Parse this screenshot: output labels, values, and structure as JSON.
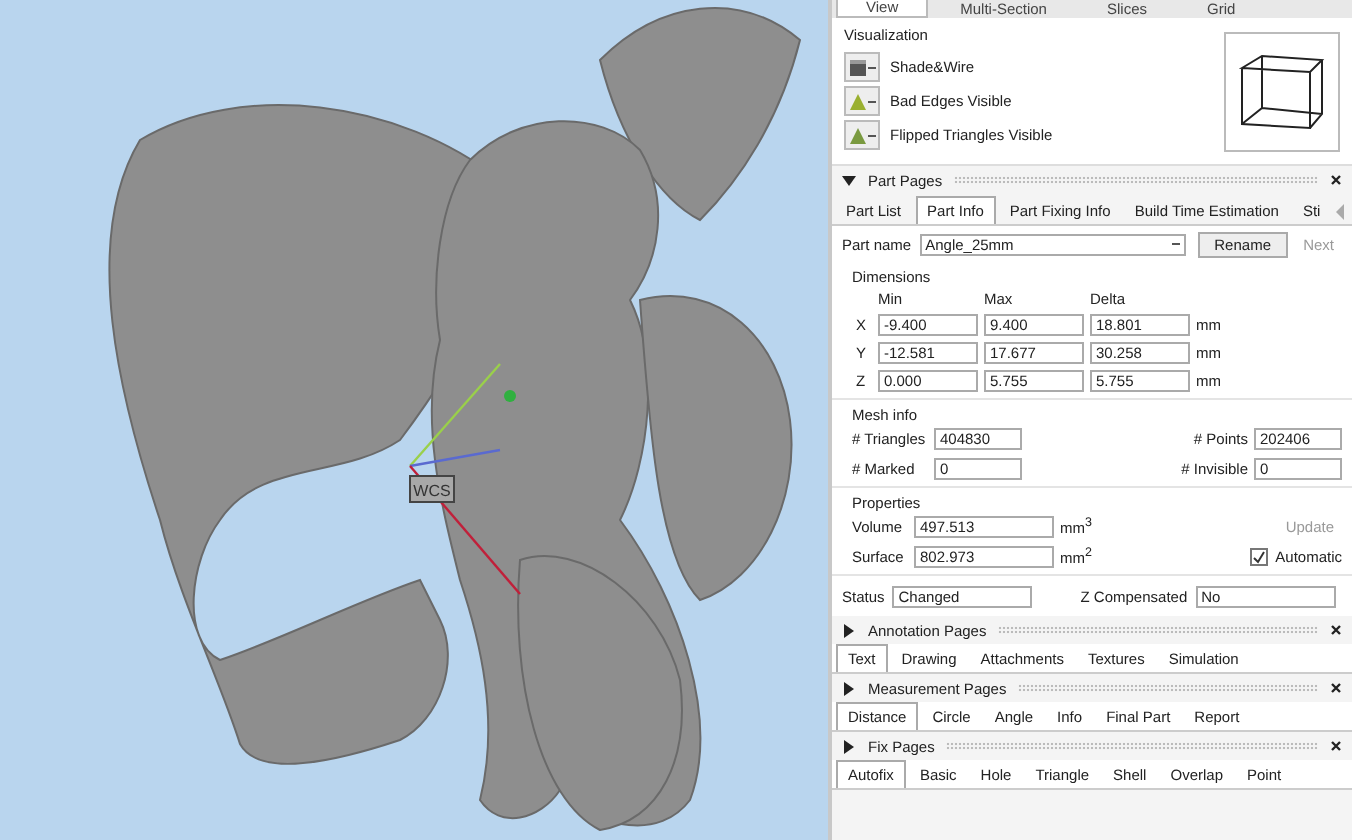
{
  "viewport": {
    "label": "WCS"
  },
  "view_tabs": [
    {
      "label": "View",
      "selected": true
    },
    {
      "label": "Multi-Section",
      "selected": false
    },
    {
      "label": "Slices",
      "selected": false
    },
    {
      "label": "Grid",
      "selected": false
    }
  ],
  "visualization": {
    "title": "Visualization",
    "items": [
      {
        "kind": "shade",
        "label": "Shade&Wire"
      },
      {
        "kind": "bad_edges",
        "label": "Bad Edges Visible"
      },
      {
        "kind": "flipped",
        "label": "Flipped Triangles Visible"
      }
    ]
  },
  "part_pages": {
    "title": "Part Pages",
    "expanded": true,
    "tabs": [
      {
        "label": "Part List",
        "selected": false
      },
      {
        "label": "Part Info",
        "selected": true
      },
      {
        "label": "Part Fixing Info",
        "selected": false
      },
      {
        "label": "Build Time Estimation",
        "selected": false
      },
      {
        "label": "Sti",
        "selected": false
      }
    ],
    "part_name_label": "Part name",
    "part_name": "Angle_25mm",
    "rename_button": "Rename",
    "next_button": {
      "label": "Next",
      "disabled": true
    },
    "dimensions": {
      "title": "Dimensions",
      "headers": [
        "Min",
        "Max",
        "Delta"
      ],
      "rows": [
        {
          "axis": "X",
          "min": "-9.400",
          "max": "9.400",
          "delta": "18.801",
          "unit": "mm"
        },
        {
          "axis": "Y",
          "min": "-12.581",
          "max": "17.677",
          "delta": "30.258",
          "unit": "mm"
        },
        {
          "axis": "Z",
          "min": "0.000",
          "max": "5.755",
          "delta": "5.755",
          "unit": "mm"
        }
      ]
    },
    "mesh_info": {
      "title": "Mesh info",
      "fields": [
        {
          "label": "# Triangles",
          "value": "404830"
        },
        {
          "label": "# Points",
          "value": "202406"
        },
        {
          "label": "# Marked",
          "value": "0"
        },
        {
          "label": "# Invisible",
          "value": "0"
        }
      ]
    },
    "properties": {
      "title": "Properties",
      "fields": [
        {
          "label": "Volume",
          "value": "497.513",
          "unit": "mm$^{3}$"
        },
        {
          "label": "Surface",
          "value": "802.973",
          "unit": "mm$^{2}$"
        }
      ],
      "update_button": {
        "label": "Update",
        "disabled": true
      },
      "automatic": {
        "label": "Automatic",
        "checked": true
      }
    },
    "status_label": "Status",
    "status": "Changed",
    "z_comp_label": "Z Compensated",
    "z_comp": "No"
  },
  "sections": [
    {
      "title": "Annotation Pages",
      "expanded": false,
      "tabs": [
        {
          "label": "Text",
          "selected": true
        },
        {
          "label": "Drawing",
          "selected": false
        },
        {
          "label": "Attachments",
          "selected": false
        },
        {
          "label": "Textures",
          "selected": false
        },
        {
          "label": "Simulation",
          "selected": false
        }
      ]
    },
    {
      "title": "Measurement Pages",
      "expanded": false,
      "tabs": [
        {
          "label": "Distance",
          "selected": true
        },
        {
          "label": "Circle",
          "selected": false
        },
        {
          "label": "Angle",
          "selected": false
        },
        {
          "label": "Info",
          "selected": false
        },
        {
          "label": "Final Part",
          "selected": false
        },
        {
          "label": "Report",
          "selected": false
        }
      ]
    },
    {
      "title": "Fix Pages",
      "expanded": false,
      "tabs": [
        {
          "label": "Autofix",
          "selected": true
        },
        {
          "label": "Basic",
          "selected": false
        },
        {
          "label": "Hole",
          "selected": false
        },
        {
          "label": "Triangle",
          "selected": false
        },
        {
          "label": "Shell",
          "selected": false
        },
        {
          "label": "Overlap",
          "selected": false
        },
        {
          "label": "Point",
          "selected": false
        }
      ]
    }
  ]
}
